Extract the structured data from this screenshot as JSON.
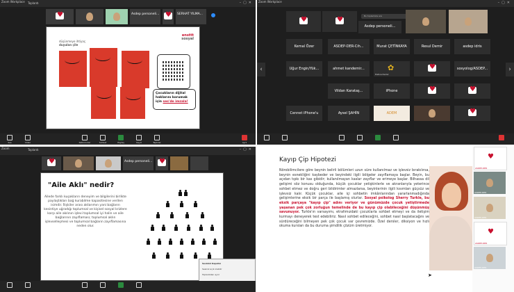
{
  "quadrant1": {
    "app_label": "Zoom Workplace",
    "tab_label": "Toplantı",
    "participants": [
      {
        "name": "Asdep personeli...",
        "kind": "logo"
      },
      {
        "name": "SERHAT YILMA...",
        "kind": "face"
      }
    ],
    "slide": {
      "logo_line1": "ensttt",
      "logo_line2": "sosyal",
      "heading_line1": "düşünmeye ihtiyaç",
      "heading_line2": "duyulan çile",
      "callout_main": "Çocukların dijital haklarını korumak için ",
      "callout_link": "ses'de imzala!"
    },
    "taskbar": [
      "Ses",
      "Video",
      "Katılımcılar",
      "Sohbet",
      "Paylaş",
      "Kayıt",
      "Tepkiler",
      "Ayrıl"
    ]
  },
  "quadrant2": {
    "app_label": "Zoom Workplace",
    "search_placeholder": "Bu toplantıda ara",
    "gallery": [
      {
        "name": "Asdep personeli...",
        "kind": "logo"
      },
      {
        "name": "Kemal Özer",
        "kind": "text"
      },
      {
        "name": "ASDEP-DER-Cih...",
        "kind": "text"
      },
      {
        "name": "Murat ÇETİNKAYA",
        "kind": "text"
      },
      {
        "name": "Resul Demir",
        "kind": "text"
      },
      {
        "name": "asdep idris",
        "kind": "text"
      },
      {
        "name": "Uğur Engin/Yük...",
        "kind": "text"
      },
      {
        "name": "ahmet kandemir...",
        "kind": "text"
      },
      {
        "name": "Hatice Demir",
        "kind": "text"
      },
      {
        "name": "sosyolog/ASDEP...",
        "kind": "text"
      },
      {
        "name": "Vildan Karataş...",
        "kind": "text"
      },
      {
        "name": "iPhone",
        "kind": "text"
      },
      {
        "name": "Cennet iPhone'u",
        "kind": "text"
      },
      {
        "name": "Aysel ŞAHİN",
        "kind": "text"
      },
      {
        "name": "ADEM",
        "kind": "text"
      }
    ]
  },
  "quadrant3": {
    "app_label": "Zoom",
    "tab_label": "Toplantı",
    "participants": [
      {
        "name": "Asdep personeli...",
        "kind": "logo"
      }
    ],
    "slide": {
      "title": "\"Aile Aklı\" nedir?",
      "paragraph": "Ailede farklı kuşakların deneyim ve bilgilerini birlikte paylaştıkları bağ kurabilme kapasitesine verilen isimdir. İlişkiler arası aktarımın yani bağların kesintiye uğradığı toplumsal ve kişisel sosyal krizlere karşı aile akılının işlevi toplumsal iyi halin ve aile bağlarının zayıflaması; toplumsal aklın işlevselleşmesi ve toplumsal bağların zayıflamasına neden olur."
    },
    "popup": {
      "line1": "Sesinizi Kapatın",
      "line2": "Sesiniz açık olabilir",
      "line3": "Toplantıdan ayrıl",
      "line4": "Tepkilerinizi ve yorumlarınızı paylaşın"
    }
  },
  "quadrant4": {
    "slide": {
      "title": "Kayıp Çip Hipotezi",
      "body_pre": "Nörobilimcilere göre beynin belirli bölümleri uzun süre kullanılmaz ve işlevsiz bırakılırsa, beynin esnekliğini kaybeder ve beyindeki ilgili bölgeler zayıflamaya başlar. Beyin, bu açıdan tıpkı bir kas gibidir; kullanılmayan kaslar zayıflar ve erimeye başlar. Bilhassa dil gelişimi söz konusu olduğunda, küçük çocuklar yetişkinlerle ve akranlarıyla yeterince sohbet etmez ve doğru geri bildirimler almazlarsa, beyinlerinin ilgili kısımları güçsüz ve işlevsiz kalır. Küçük çocuklar, aile içi sohbetin imkânlarından yararlanmadığında gelişimlerine eksik bir parça ile başlamış olurlar. ",
      "body_hl": "Sosyal psikolog Sherry Turkle, bu eksik parçaya \"kayıp çip\" adını veriyor ve günümüzde çocuk yetiştirmede yaşanan pek çok zorluğun temelinde de bu kayıp çip olabileceğini düşünmüş savunuyor.",
      "body_post": " Turkle'ın varsayımı, etrafımızdaki çocuklarla sohbet etmeyi ve da iletişim kurmayı deneyerek test edebiliriz. Nasıl sohbet edileceğini, sohbet nasıl başlatacağını ve sürdüreceğini bilmeyen pek çok çocuk var çevremizde. Özel dersler, diksiyon ve hızlı okuma kursları da bu duruma şimdilik çözüm üretmiyor."
    },
    "sidebar": [
      {
        "name": "ASDEP-DER"
      },
      {
        "name": "ASDEP-DER"
      },
      {
        "name": "ASDEP-DER"
      },
      {
        "name": "ASDEP-DER"
      },
      {
        "name": "ASDEP-DER"
      }
    ]
  },
  "colors": {
    "accent_red": "#c8102e",
    "zoom_dark": "#1e1e1e",
    "book_red": "#d93a2b"
  }
}
